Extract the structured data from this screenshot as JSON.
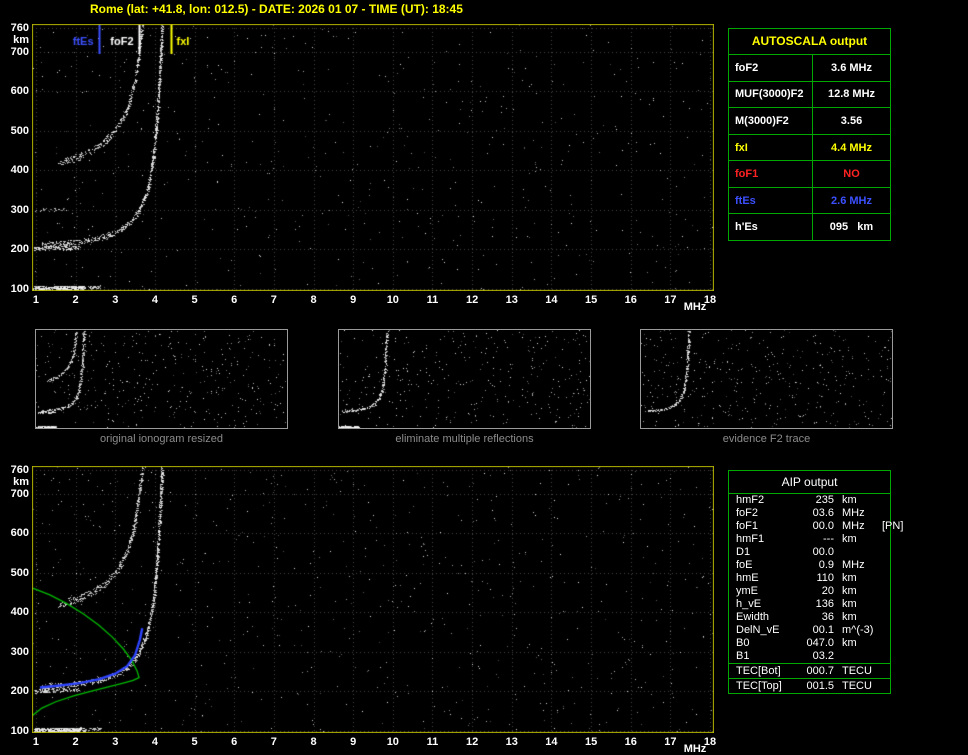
{
  "header": {
    "title": "Rome (lat: +41.8, lon: 012.5) - DATE: 2026 01 07 - TIME (UT): 18:45"
  },
  "colors": {
    "background": "#000000",
    "title": "#ffff00",
    "plot_frame": "#b4b400",
    "grid": "#464646",
    "axis_text": "#ffffff",
    "table_border": "#00a800",
    "trace_dots": "#e8e8e8",
    "profile_green": "#00bb00",
    "fitted_blue": "#2e44ff",
    "ftes_blue": "#3c50ff",
    "fxi_yellow": "#ffff00",
    "fof1_red": "#ff2222",
    "caption_gray": "#8c8c8c"
  },
  "autoscala": {
    "title": "AUTOSCALA output",
    "rows": [
      {
        "label": "foF2",
        "value": "3.6 MHz",
        "color": "#ffffff"
      },
      {
        "label": "MUF(3000)F2",
        "value": "12.8 MHz",
        "color": "#ffffff"
      },
      {
        "label": "M(3000)F2",
        "value": "3.56",
        "color": "#ffffff"
      },
      {
        "label": "fxI",
        "value": "4.4 MHz",
        "color": "#ffff00"
      },
      {
        "label": "foF1",
        "value": "NO",
        "color": "#ff2222"
      },
      {
        "label": "ftEs",
        "value": "2.6 MHz",
        "color": "#3c50ff"
      },
      {
        "label": "h'Es",
        "value": "095   km",
        "color": "#ffffff"
      }
    ]
  },
  "aip": {
    "title": "AIP output",
    "rows": [
      {
        "label": "hmF2",
        "value": "235",
        "unit": "km",
        "extra": "",
        "sep": false
      },
      {
        "label": "foF2",
        "value": "03.6",
        "unit": "MHz",
        "extra": "",
        "sep": false
      },
      {
        "label": "foF1",
        "value": "00.0",
        "unit": "MHz",
        "extra": "[PN]",
        "sep": false
      },
      {
        "label": "hmF1",
        "value": "---",
        "unit": "km",
        "extra": "",
        "sep": false
      },
      {
        "label": "D1",
        "value": "00.0",
        "unit": "",
        "extra": "",
        "sep": false
      },
      {
        "label": "foE",
        "value": "0.9",
        "unit": "MHz",
        "extra": "",
        "sep": false
      },
      {
        "label": "hmE",
        "value": "110",
        "unit": "km",
        "extra": "",
        "sep": false
      },
      {
        "label": "ymE",
        "value": "20",
        "unit": "km",
        "extra": "",
        "sep": false
      },
      {
        "label": "h_vE",
        "value": "136",
        "unit": "km",
        "extra": "",
        "sep": false
      },
      {
        "label": "Ewidth",
        "value": "36",
        "unit": "km",
        "extra": "",
        "sep": false
      },
      {
        "label": "DelN_vE",
        "value": "00.1",
        "unit": "m^(-3)",
        "extra": "",
        "sep": false
      },
      {
        "label": "B0",
        "value": "047.0",
        "unit": "km",
        "extra": "",
        "sep": false
      },
      {
        "label": "B1",
        "value": "03.2",
        "unit": "",
        "extra": "",
        "sep": false
      },
      {
        "label": "TEC[Bot]",
        "value": "000.7",
        "unit": "TECU",
        "extra": "",
        "sep": true
      },
      {
        "label": "TEC[Top]",
        "value": "001.5",
        "unit": "TECU",
        "extra": "",
        "sep": true
      }
    ]
  },
  "chart_data": {
    "type": "scatter",
    "x_axis": {
      "label": "MHz",
      "min": 0.9,
      "max": 18.1,
      "ticks": [
        1,
        2,
        3,
        4,
        5,
        6,
        7,
        8,
        9,
        10,
        11,
        12,
        13,
        14,
        15,
        16,
        17,
        18
      ]
    },
    "y_axis": {
      "label": "km",
      "min": 95,
      "max": 770,
      "ticks": [
        760,
        700,
        600,
        500,
        400,
        300,
        200,
        100
      ]
    },
    "scaled_values": {
      "foF2_MHz": 3.6,
      "fxI_MHz": 4.4,
      "ftEs_MHz": 2.6,
      "hEs_km": 95,
      "hmF2_km": 235
    },
    "trace_library": {
      "es": {
        "color": "#f0f0f0",
        "density": 7.0,
        "jh": 5,
        "points": [
          [
            0.95,
            103
          ],
          [
            2.2,
            104
          ]
        ]
      },
      "es_tail": {
        "color": "#e0e0e0",
        "density": 2.0,
        "jh": 4,
        "points": [
          [
            2.2,
            104
          ],
          [
            2.65,
            106
          ]
        ]
      },
      "es2": {
        "color": "#e8e8e8",
        "density": 2.5,
        "jh": 5,
        "points": [
          [
            0.95,
            202
          ],
          [
            2.1,
            205
          ]
        ]
      },
      "es3": {
        "color": "#d8d8d8",
        "density": 0.8,
        "jh": 5,
        "points": [
          [
            0.95,
            300
          ],
          [
            1.7,
            303
          ]
        ]
      },
      "f1": {
        "color": "#e8e8e8",
        "density": 2.6,
        "jh": 7,
        "points": [
          [
            1.15,
            212
          ],
          [
            1.7,
            216
          ],
          [
            2.2,
            222
          ],
          [
            2.7,
            232
          ],
          [
            3.05,
            246
          ],
          [
            3.35,
            266
          ],
          [
            3.6,
            298
          ],
          [
            3.8,
            348
          ],
          [
            3.95,
            425
          ],
          [
            4.05,
            530
          ],
          [
            4.12,
            650
          ],
          [
            4.18,
            768
          ]
        ]
      },
      "f2": {
        "color": "#e4e4e4",
        "density": 2.2,
        "jh": 9,
        "points": [
          [
            1.55,
            420
          ],
          [
            2.0,
            432
          ],
          [
            2.4,
            450
          ],
          [
            2.75,
            474
          ],
          [
            3.05,
            508
          ],
          [
            3.3,
            556
          ],
          [
            3.5,
            630
          ],
          [
            3.62,
            720
          ],
          [
            3.68,
            768
          ]
        ]
      }
    },
    "top_ionogram": {
      "seed": 7,
      "noise_points": 560,
      "trace_refs": [
        "es",
        "es_tail",
        "es2",
        "es3",
        "f1",
        "f2"
      ],
      "markers": [
        {
          "label": "ftEs",
          "freq": 2.6,
          "color": "#3c50ff",
          "side": "left"
        },
        {
          "label": "foF2",
          "freq": 3.6,
          "color": "#ffffff",
          "side": "left"
        },
        {
          "label": "fxI",
          "freq": 4.4,
          "color": "#ffff00",
          "side": "right"
        }
      ]
    },
    "bottom_ionogram": {
      "seed": 13,
      "noise_points": 680,
      "trace_refs": [
        "es",
        "es_tail",
        "es2",
        "f1",
        "f2"
      ],
      "profile": {
        "color": "#00bb00",
        "points": [
          [
            0.88,
            100
          ],
          [
            0.9,
            112
          ],
          [
            0.86,
            124
          ],
          [
            0.92,
            140
          ],
          [
            1.15,
            158
          ],
          [
            1.5,
            174
          ],
          [
            1.95,
            189
          ],
          [
            2.4,
            201
          ],
          [
            2.85,
            212
          ],
          [
            3.2,
            221
          ],
          [
            3.45,
            228
          ],
          [
            3.6,
            235
          ],
          [
            3.55,
            252
          ],
          [
            3.42,
            278
          ],
          [
            3.2,
            308
          ],
          [
            2.92,
            338
          ],
          [
            2.58,
            368
          ],
          [
            2.2,
            396
          ],
          [
            1.78,
            422
          ],
          [
            1.35,
            444
          ],
          [
            0.95,
            460
          ],
          [
            0.88,
            462
          ]
        ]
      },
      "fitted_trace": {
        "color": "#2e44ff",
        "points": [
          [
            1.1,
            210
          ],
          [
            1.6,
            215
          ],
          [
            2.1,
            221
          ],
          [
            2.6,
            231
          ],
          [
            3.0,
            245
          ],
          [
            3.3,
            264
          ],
          [
            3.5,
            292
          ],
          [
            3.62,
            330
          ],
          [
            3.68,
            360
          ]
        ]
      }
    },
    "thumbnails": [
      {
        "caption": "original ionogram resized",
        "seed": 3,
        "noise_points": 400,
        "trace_refs": [
          "es",
          "es2",
          "f1",
          "f2"
        ]
      },
      {
        "caption": "eliminate multiple reflections",
        "seed": 4,
        "noise_points": 360,
        "trace_refs": [
          "es",
          "f1"
        ]
      },
      {
        "caption": "evidence F2 trace",
        "seed": 5,
        "noise_points": 420,
        "trace_refs": [
          "f1"
        ]
      }
    ]
  }
}
